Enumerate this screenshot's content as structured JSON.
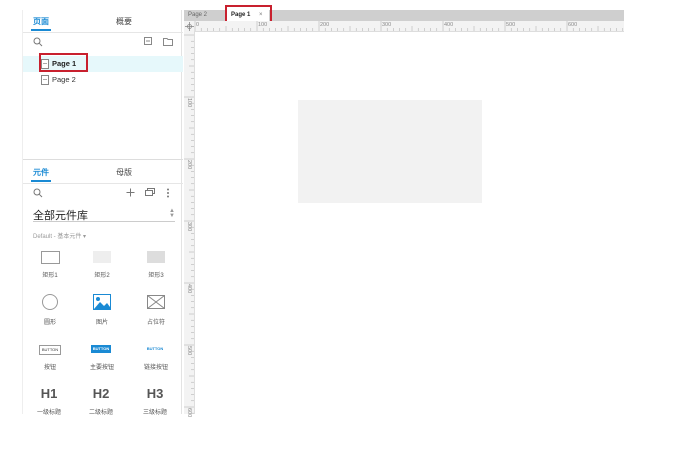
{
  "left_panel": {
    "pages_tabs": [
      {
        "label": "页面",
        "active": true
      },
      {
        "label": "概要",
        "active": false
      }
    ],
    "pages_toolbar_icons": [
      "search-icon",
      "collapse-icon",
      "folder-icon"
    ],
    "pages": [
      {
        "label": "Page 1",
        "selected": true
      },
      {
        "label": "Page 2",
        "selected": false
      }
    ],
    "library_tabs": [
      {
        "label": "元件",
        "active": true
      },
      {
        "label": "母版",
        "active": false
      }
    ],
    "library_toolbar_icons": [
      "search-icon",
      "add-icon",
      "copy-icon",
      "more-icon"
    ],
    "library_select": "全部元件库",
    "library_subtitle": "Default - 基本元件 ▾",
    "widgets": [
      {
        "label": "矩形1",
        "kind": "rect1"
      },
      {
        "label": "矩形2",
        "kind": "rect2"
      },
      {
        "label": "矩形3",
        "kind": "rect3"
      },
      {
        "label": "圆形",
        "kind": "circle"
      },
      {
        "label": "图片",
        "kind": "image"
      },
      {
        "label": "占位符",
        "kind": "placeholder"
      },
      {
        "label": "按钮",
        "kind": "button",
        "preview": "BUTTON"
      },
      {
        "label": "主要按钮",
        "kind": "primary-button",
        "preview": "BUTTON"
      },
      {
        "label": "链接按钮",
        "kind": "link-button",
        "preview": "BUTTON"
      },
      {
        "label": "一级标题",
        "kind": "h1",
        "preview": "H1"
      },
      {
        "label": "二级标题",
        "kind": "h2",
        "preview": "H2"
      },
      {
        "label": "三级标题",
        "kind": "h3",
        "preview": "H3"
      }
    ]
  },
  "document_tabs": [
    {
      "label": "Page 2",
      "active": false
    },
    {
      "label": "Page 1",
      "active": true,
      "close": "×"
    }
  ],
  "rulers": {
    "horizontal": [
      "0",
      "100",
      "200",
      "300",
      "400",
      "500",
      "600"
    ],
    "vertical": [
      "100",
      "200",
      "300",
      "400",
      "500",
      "600"
    ]
  },
  "colors": {
    "accent": "#1a8ad4",
    "highlight": "#c8202e",
    "selection": "#e6f8fb"
  }
}
